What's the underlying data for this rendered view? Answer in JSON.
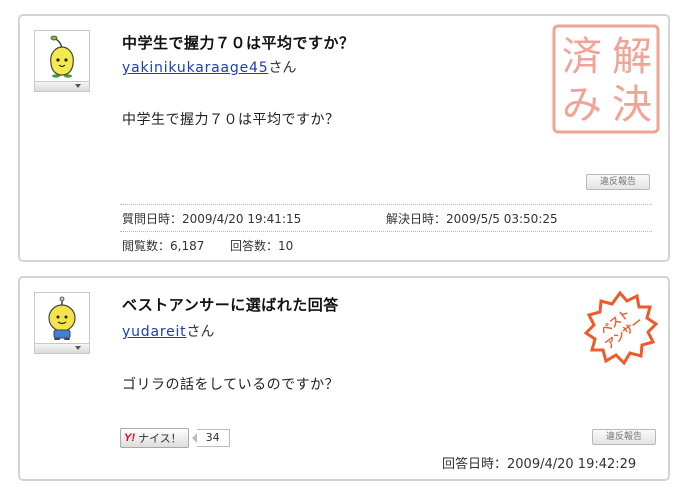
{
  "question": {
    "title": "中学生で握力７０は平均ですか？",
    "user": "yakinikukaraage45",
    "user_suffix": "さん",
    "body": "中学生で握力７０は平均ですか？",
    "report_label": "違反報告",
    "asked_label": "質問日時：",
    "asked_at": "2009/4/20 19:41:15",
    "resolved_label": "解決日時：",
    "resolved_at": "2009/5/5 03:50:25",
    "views_label": "閲覧数：",
    "views": "6,187",
    "answers_label": "回答数：",
    "answers": "10",
    "stamp_chars": [
      "解",
      "決",
      "済",
      "み"
    ],
    "stamp_color": "#f2a395"
  },
  "best_answer": {
    "heading": "ベストアンサーに選ばれた回答",
    "user": "yudareit",
    "user_suffix": "さん",
    "body": "ゴリラの話をしているのですか？",
    "nice_logo": "Y!",
    "nice_label": "ナイス！",
    "nice_count": "34",
    "report_label": "違反報告",
    "answered_label": "回答日時：",
    "answered_at": "2009/4/20 19:42:29",
    "stamp_lines": [
      "ベスト",
      "アンサー"
    ],
    "stamp_color": "#ef5a2a"
  }
}
